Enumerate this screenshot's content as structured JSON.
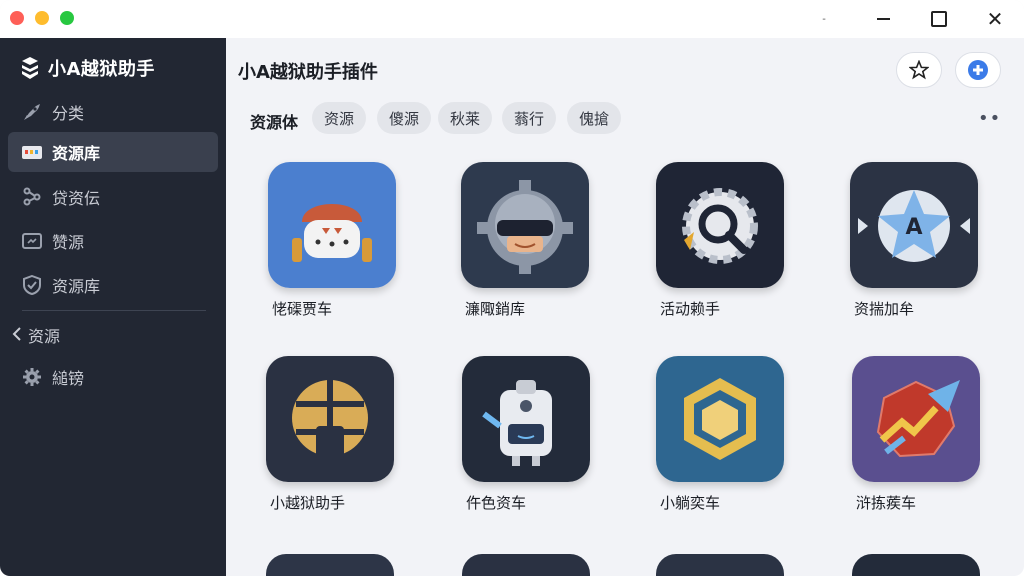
{
  "window": {
    "min_glyph": "-",
    "close_glyph": "✕"
  },
  "sidebar": {
    "brand": "小A越狱助手",
    "items": [
      {
        "label": "分类",
        "icon": "rocket-icon"
      },
      {
        "label": "资源库",
        "icon": "folder-icon",
        "active": true
      },
      {
        "label": "贷资伝",
        "icon": "share-icon"
      },
      {
        "label": "赞源",
        "icon": "image-icon"
      },
      {
        "label": "资源库",
        "icon": "shield-icon"
      }
    ],
    "sub_header": "资源",
    "settings_label": "縋镑"
  },
  "header": {
    "title": "小A越狱助手插件"
  },
  "filters": {
    "label": "资源体",
    "chips": [
      "资源",
      "傻源",
      "秋莱",
      "蓊行",
      "傀搶"
    ],
    "more": "••"
  },
  "apps": [
    {
      "label": "恅磲贾车",
      "icon": "robot-helmet-icon"
    },
    {
      "label": "濂陬銷库",
      "icon": "gear-robot-icon"
    },
    {
      "label": "活动赖手",
      "icon": "search-gear-icon"
    },
    {
      "label": "资揣加牟",
      "icon": "star-a-icon"
    },
    {
      "label": "小越狱助手",
      "icon": "shell-icon"
    },
    {
      "label": "仵色资车",
      "icon": "robot-box-icon"
    },
    {
      "label": "小躺奕车",
      "icon": "cube-icon"
    },
    {
      "label": "浒拣蒺车",
      "icon": "chart-arrow-icon"
    }
  ]
}
